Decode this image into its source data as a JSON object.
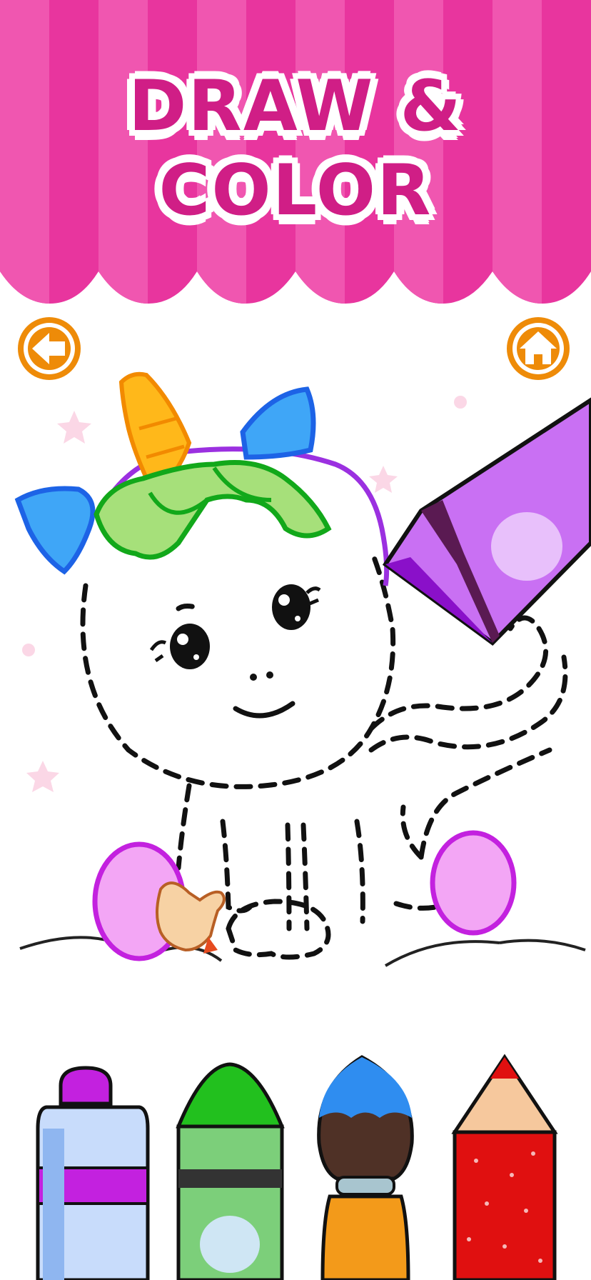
{
  "header": {
    "title_line1": "DRAW &",
    "title_line2": "COLOR",
    "bg_color": "#e8359e",
    "stripe_color": "#f056b0",
    "title_color": "#d01e86"
  },
  "nav": {
    "back_icon": "arrow-left-icon",
    "home_icon": "home-icon",
    "button_color": "#ee8b08"
  },
  "tools": [
    {
      "name": "marker",
      "color": "#c21fd4"
    },
    {
      "name": "crayon",
      "color": "#22c01e"
    },
    {
      "name": "paintbrush",
      "color": "#1f8fe8"
    },
    {
      "name": "glitter-pencil",
      "color": "#e01010"
    }
  ]
}
